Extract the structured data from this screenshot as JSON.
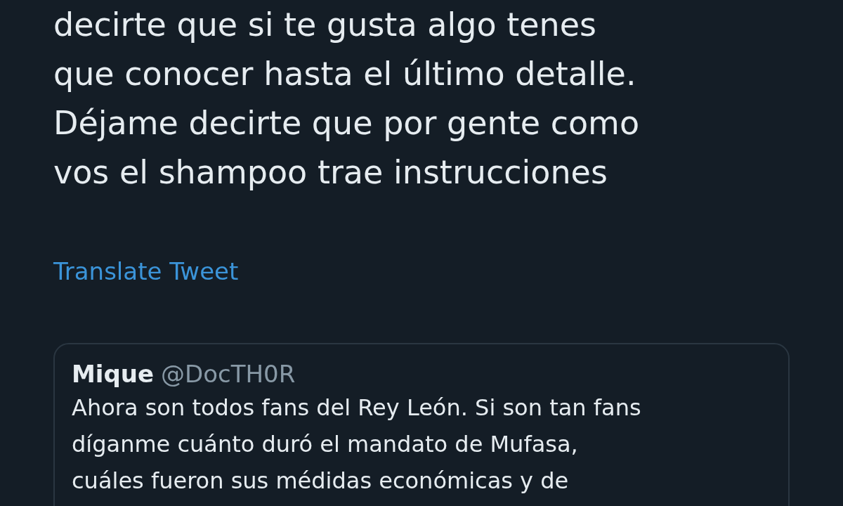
{
  "tweet": {
    "text_lines": [
      "decirte que si te gusta algo tenes",
      "que conocer hasta el último detalle.",
      "Déjame decirte que por gente como",
      "vos el shampoo trae instrucciones"
    ],
    "translate_link": "Translate Tweet",
    "quoted_tweet": {
      "name": "Mique",
      "handle": "@DocTH0R",
      "text_lines": [
        "Ahora son todos fans del Rey León. Si son tan fans",
        "díganme cuánto duró el mandato de Mufasa,",
        "cuáles fueron sus médidas económicas y de"
      ]
    }
  }
}
